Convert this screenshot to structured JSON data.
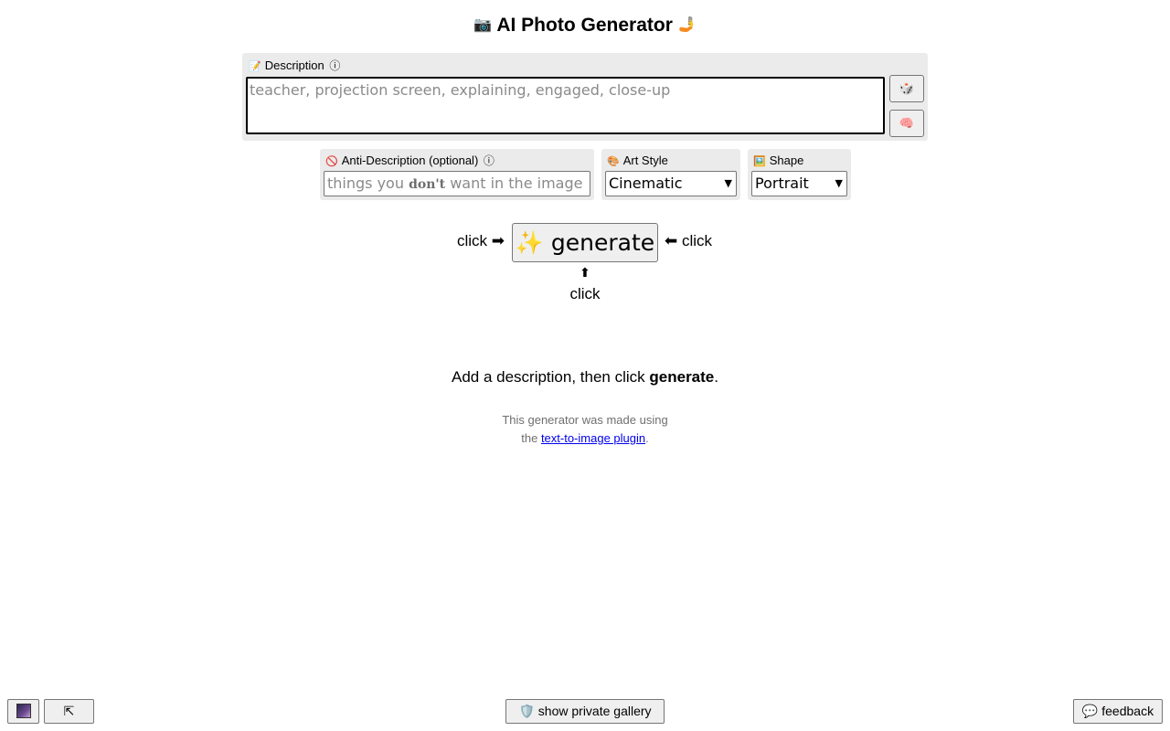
{
  "header": {
    "title": "AI Photo Generator",
    "left_emoji": "📷",
    "right_emoji": "🤳"
  },
  "description": {
    "label": "Description",
    "label_emoji": "📝",
    "info_glyph": "ⓘ",
    "placeholder": "teacher, projection screen, explaining, engaged, close-up",
    "value": "",
    "dice_icon": "🎲",
    "brain_icon": "🧠"
  },
  "anti_description": {
    "label": "Anti-Description (optional)",
    "label_icon": "🚫",
    "info_glyph": "ⓘ",
    "placeholder_before": "things you ",
    "placeholder_bold": "don't",
    "placeholder_after": " want in the image"
  },
  "art_style": {
    "label": "Art Style",
    "label_emoji": "🎨",
    "selected": "Cinematic"
  },
  "shape": {
    "label": "Shape",
    "label_emoji": "🖼️",
    "selected": "Portrait"
  },
  "generate": {
    "button_label": "✨ generate",
    "click_left": "click ➡",
    "click_right": "⬅ click",
    "arrow_up": "⬆",
    "click_below": "click"
  },
  "hint": {
    "before": "Add a description, then click ",
    "bold": "generate",
    "after": "."
  },
  "credits": {
    "line1": "This generator was made using",
    "line2_before": "the ",
    "link_text": "text-to-image plugin",
    "line2_after": "."
  },
  "bottom_bar": {
    "top_button_label": "⇱",
    "private_gallery_icon": "🛡️",
    "private_gallery_label": "show private gallery",
    "feedback_icon": "💬",
    "feedback_label": "feedback"
  },
  "colors": {
    "panel_bg": "#ebebeb",
    "link": "#0000ee",
    "placeholder": "#8a8a8a"
  }
}
